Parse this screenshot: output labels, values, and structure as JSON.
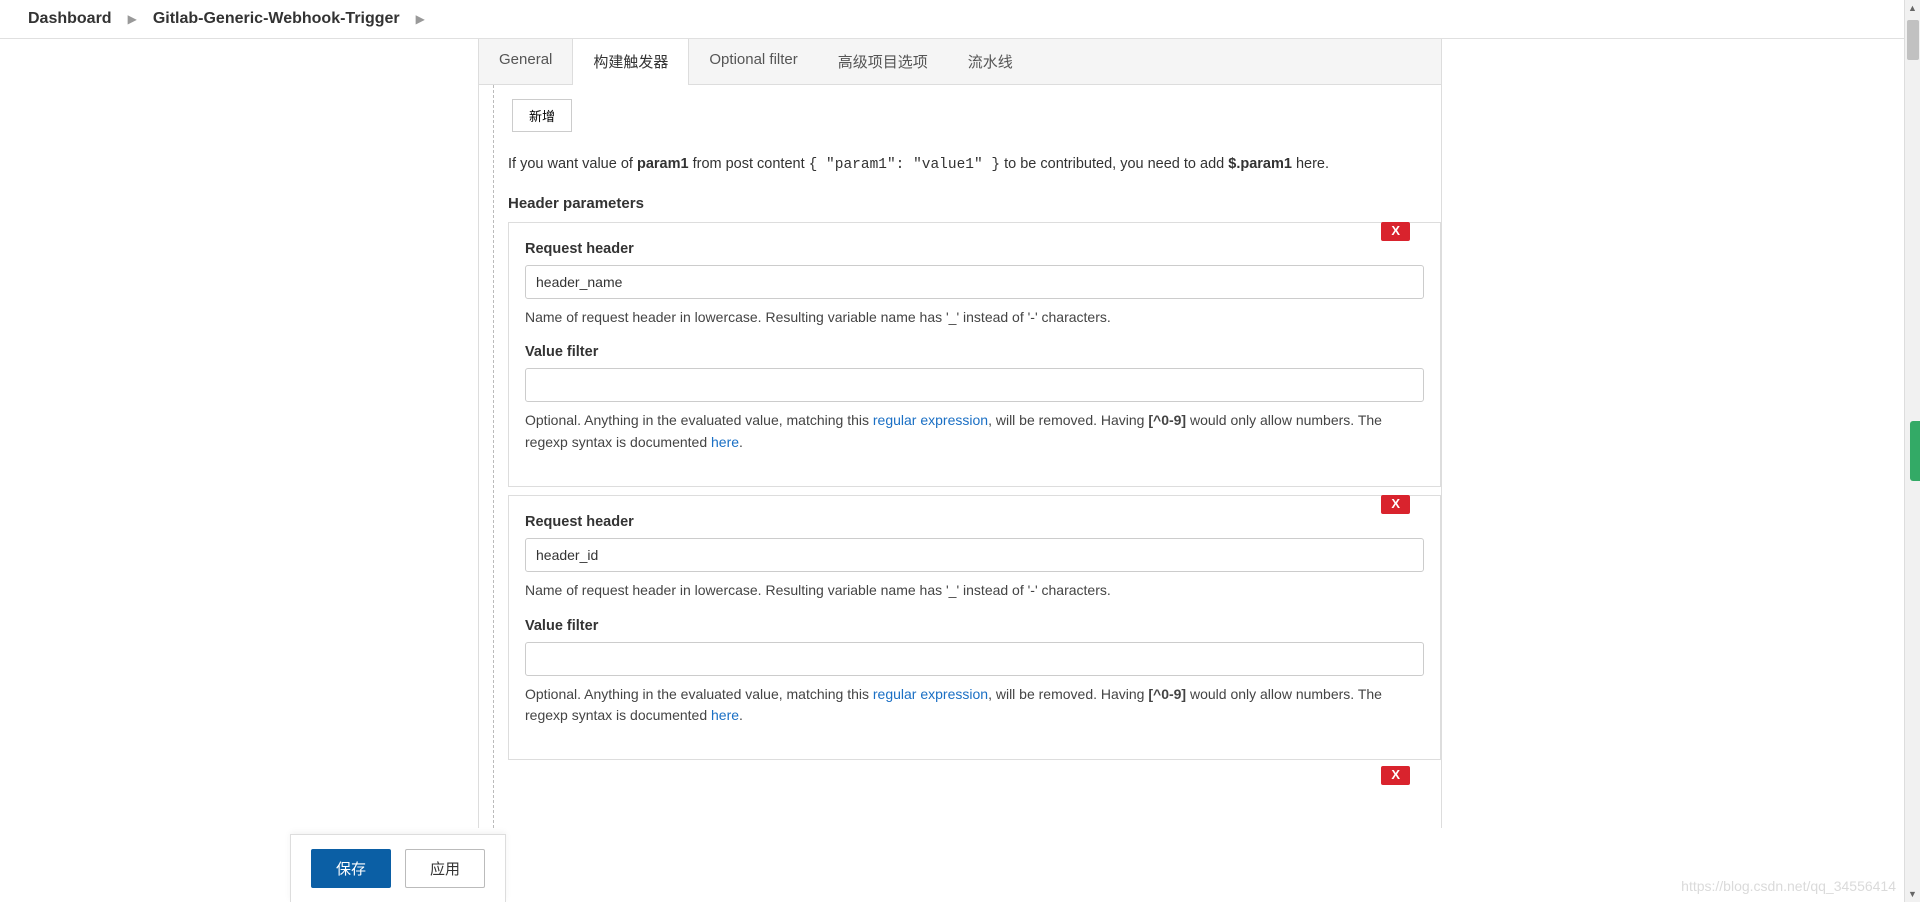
{
  "breadcrumb": {
    "dashboard": "Dashboard",
    "job": "Gitlab-Generic-Webhook-Trigger"
  },
  "tabs": {
    "general": "General",
    "triggers": "构建触发器",
    "optional_filter": "Optional filter",
    "advanced": "高级项目选项",
    "pipeline": "流水线"
  },
  "buttons": {
    "add": "新增",
    "save": "保存",
    "apply": "应用",
    "delete": "X"
  },
  "hint": {
    "line1_a": "If you want value of ",
    "line1_b": "param1",
    "line1_c": " from post content ",
    "line1_code": "{ \"param1\": \"value1\" }",
    "line1_d": " to be contributed, you need to add ",
    "line1_e": "$.param1",
    "line1_f": " here."
  },
  "section": {
    "header_params": "Header parameters"
  },
  "labels": {
    "request_header": "Request header",
    "value_filter": "Value filter"
  },
  "desc": {
    "header_name": "Name of request header in lowercase. Resulting variable name has '_' instead of '-' characters.",
    "vf_a": "Optional. Anything in the evaluated value, matching this ",
    "vf_link1": "regular expression",
    "vf_b": ", will be removed. Having ",
    "vf_code": "[^0-9]",
    "vf_c": " would only allow numbers. The regexp syntax is documented ",
    "vf_link2": "here",
    "vf_d": "."
  },
  "params": [
    {
      "header": "header_name",
      "filter": ""
    },
    {
      "header": "header_id",
      "filter": ""
    }
  ],
  "watermark": "https://blog.csdn.net/qq_34556414"
}
